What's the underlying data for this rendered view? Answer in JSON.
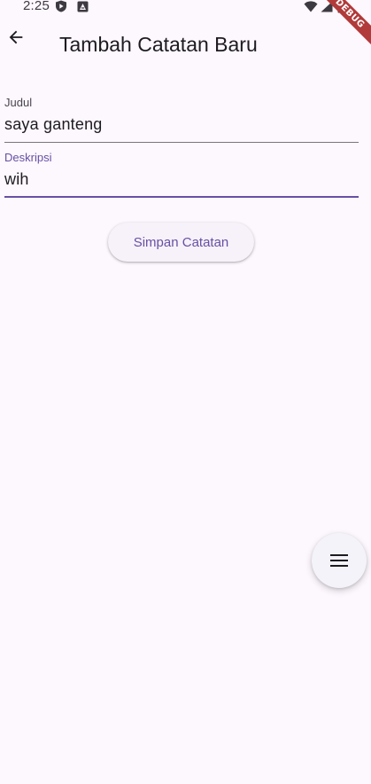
{
  "status_bar": {
    "time": "2:25",
    "debug_banner": "DEBUG"
  },
  "app_bar": {
    "title": "Tambah Catatan Baru",
    "back_icon": "arrow-back-icon"
  },
  "form": {
    "title_field": {
      "label": "Judul",
      "value": "saya ganteng"
    },
    "description_field": {
      "label": "Deskripsi",
      "value": "wih"
    },
    "save_button_label": "Simpan Catatan"
  },
  "fab": {
    "icon": "menu-icon"
  },
  "colors": {
    "background": "#fdf7fe",
    "primary": "#6750a4",
    "on_surface": "#1d1b20",
    "label_inactive": "#49454f",
    "underline_inactive": "#79747e",
    "button_surface": "#f7f1f9",
    "debug_ribbon": "#b13a3a"
  }
}
